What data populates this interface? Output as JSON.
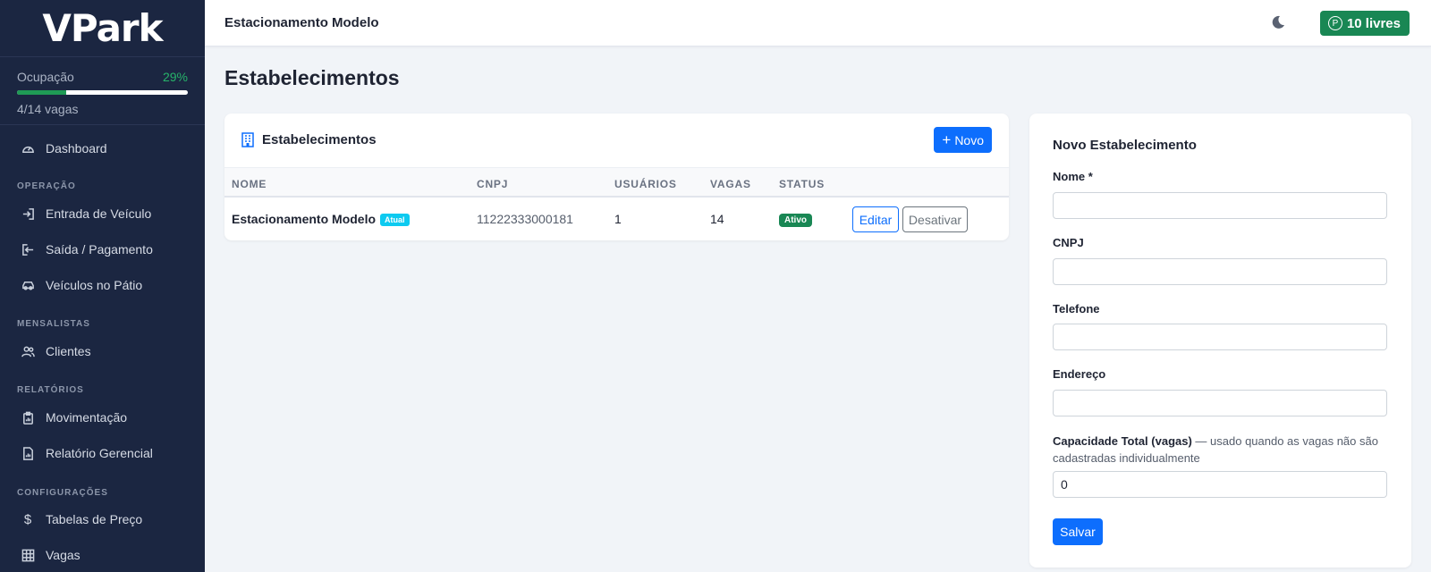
{
  "app": {
    "logo": "VPark"
  },
  "occupancy": {
    "label": "Ocupação",
    "percent_text": "29%",
    "fraction": 0.29,
    "spots_text": "4/14 vagas"
  },
  "sidebar": {
    "dashboard": {
      "label": "Dashboard",
      "icon": "speedometer-icon"
    },
    "sections": [
      {
        "title": "OPERAÇÃO",
        "items": [
          {
            "label": "Entrada de Veículo",
            "icon": "login-icon"
          },
          {
            "label": "Saída / Pagamento",
            "icon": "logout-icon"
          },
          {
            "label": "Veículos no Pátio",
            "icon": "car-icon"
          }
        ]
      },
      {
        "title": "MENSALISTAS",
        "items": [
          {
            "label": "Clientes",
            "icon": "people-icon"
          }
        ]
      },
      {
        "title": "RELATÓRIOS",
        "items": [
          {
            "label": "Movimentação",
            "icon": "clipboard-data-icon"
          },
          {
            "label": "Relatório Gerencial",
            "icon": "file-chart-icon"
          }
        ]
      },
      {
        "title": "CONFIGURAÇÕES",
        "items": [
          {
            "label": "Tabelas de Preço",
            "icon": "dollar-icon"
          },
          {
            "label": "Vagas",
            "icon": "grid-icon"
          }
        ]
      }
    ]
  },
  "topbar": {
    "title": "Estacionamento Modelo",
    "free_spots": "10 livres",
    "free_icon": "parking-icon",
    "theme_icon": "moon-icon"
  },
  "page": {
    "title": "Estabelecimentos"
  },
  "list": {
    "title": "Estabelecimentos",
    "icon": "building-icon",
    "new_button": "Novo",
    "columns": [
      "NOME",
      "CNPJ",
      "USUÁRIOS",
      "VAGAS",
      "STATUS"
    ],
    "rows": [
      {
        "name": "Estacionamento Modelo",
        "current_badge": "Atual",
        "cnpj": "11222333000181",
        "users": "1",
        "spots": "14",
        "status": "Ativo",
        "edit": "Editar",
        "disable": "Desativar"
      }
    ]
  },
  "form": {
    "title": "Novo Estabelecimento",
    "fields": {
      "nome": {
        "label": "Nome *",
        "value": ""
      },
      "cnpj": {
        "label": "CNPJ",
        "value": ""
      },
      "telefone": {
        "label": "Telefone",
        "value": ""
      },
      "endereco": {
        "label": "Endereço",
        "value": ""
      },
      "capacidade": {
        "label": "Capacidade Total (vagas)",
        "help": " — usado quando as vagas não são cadastradas individualmente",
        "value": "0"
      }
    },
    "save": "Salvar"
  },
  "colors": {
    "sidebar_bg": "#1b2641",
    "primary": "#0d6efd",
    "success": "#198754",
    "info": "#0dcaf0",
    "page_bg": "#f1f4f8"
  }
}
